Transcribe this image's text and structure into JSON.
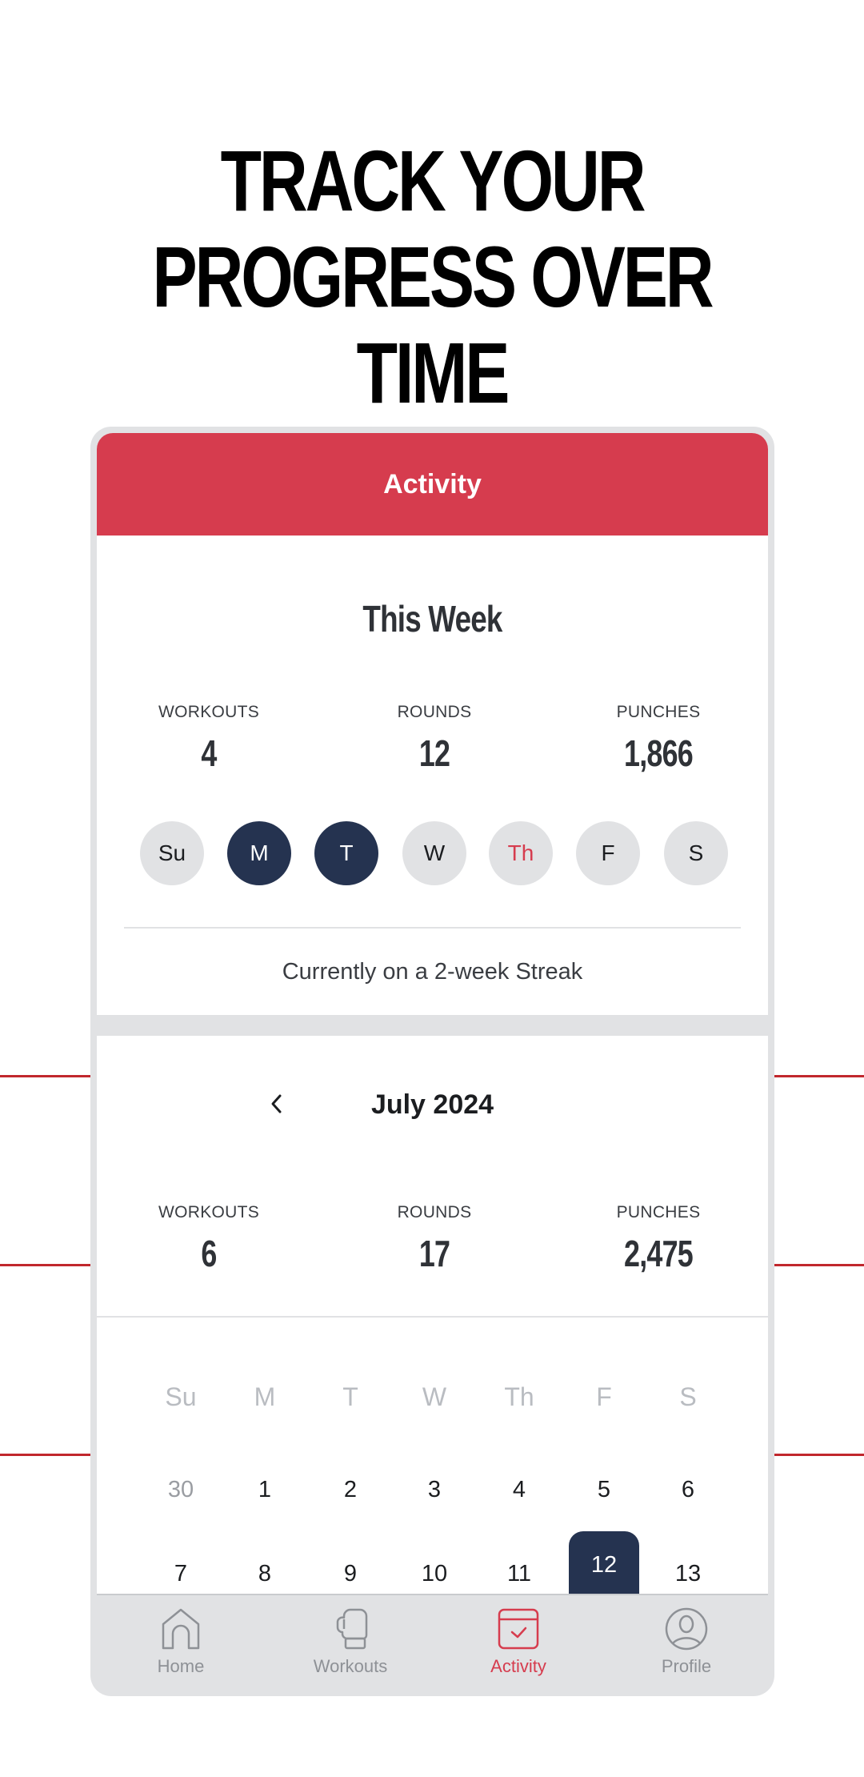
{
  "promo": {
    "headline_line1": "TRACK YOUR",
    "headline_line2": "PROGRESS OVER TIME"
  },
  "colors": {
    "accent": "#d63c4e",
    "navy": "#253350",
    "frame_gray": "#e1e2e4",
    "side_line_red": "#c1272d"
  },
  "app": {
    "header_title": "Activity"
  },
  "this_week": {
    "title": "This Week",
    "stats": [
      {
        "label": "WORKOUTS",
        "value": "4"
      },
      {
        "label": "ROUNDS",
        "value": "12"
      },
      {
        "label": "PUNCHES",
        "value": "1,866"
      }
    ],
    "days": [
      {
        "label": "Su",
        "state": "none"
      },
      {
        "label": "M",
        "state": "done"
      },
      {
        "label": "T",
        "state": "done"
      },
      {
        "label": "W",
        "state": "none"
      },
      {
        "label": "Th",
        "state": "today"
      },
      {
        "label": "F",
        "state": "none"
      },
      {
        "label": "S",
        "state": "none"
      }
    ],
    "streak_text": "Currently on a 2-week Streak"
  },
  "month": {
    "title": "July 2024",
    "prev_icon": "chevron-left-icon",
    "stats": [
      {
        "label": "WORKOUTS",
        "value": "6"
      },
      {
        "label": "ROUNDS",
        "value": "17"
      },
      {
        "label": "PUNCHES",
        "value": "2,475"
      }
    ],
    "weekday_headers": [
      "Su",
      "M",
      "T",
      "W",
      "Th",
      "F",
      "S"
    ],
    "weeks": [
      [
        {
          "day": "30",
          "state": "other"
        },
        {
          "day": "1",
          "state": "normal"
        },
        {
          "day": "2",
          "state": "normal"
        },
        {
          "day": "3",
          "state": "normal"
        },
        {
          "day": "4",
          "state": "normal"
        },
        {
          "day": "5",
          "state": "normal"
        },
        {
          "day": "6",
          "state": "normal"
        }
      ],
      [
        {
          "day": "7",
          "state": "normal"
        },
        {
          "day": "8",
          "state": "normal"
        },
        {
          "day": "9",
          "state": "normal"
        },
        {
          "day": "10",
          "state": "normal"
        },
        {
          "day": "11",
          "state": "normal"
        },
        {
          "day": "12",
          "state": "selected"
        },
        {
          "day": "13",
          "state": "normal"
        }
      ]
    ]
  },
  "nav": {
    "items": [
      {
        "label": "Home",
        "icon": "home-icon",
        "active": false
      },
      {
        "label": "Workouts",
        "icon": "boxing-glove-icon",
        "active": false
      },
      {
        "label": "Activity",
        "icon": "calendar-check-icon",
        "active": true
      },
      {
        "label": "Profile",
        "icon": "profile-icon",
        "active": false
      }
    ]
  }
}
